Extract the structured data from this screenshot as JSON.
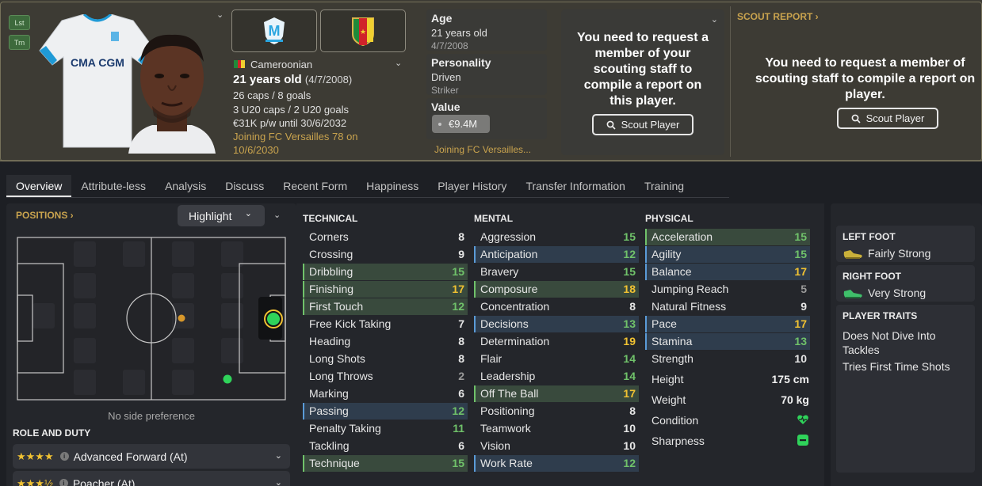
{
  "header": {
    "side_buttons": [
      "Lst",
      "Trn"
    ],
    "nationality": "Cameroonian",
    "age_main": "21 years old",
    "age_dob": "(4/7/2008)",
    "caps": "26 caps / 8 goals",
    "u20_caps": "3 U20 caps / 2 U20 goals",
    "contract": "€31K p/w until 30/6/2032",
    "joining": "Joining FC Versailles 78 on 10/6/2030",
    "colors": {
      "flag_green": "#1f8a3a",
      "flag_red": "#d0232a",
      "flag_yellow": "#f0d030",
      "accent_gold": "#c9a34e"
    }
  },
  "cards": {
    "age_title": "Age",
    "age_value": "21 years old",
    "age_dob": "4/7/2008",
    "personality_title": "Personality",
    "personality_value": "Driven",
    "personality_sub": "Striker",
    "value_title": "Value",
    "value_amount": "€9.4M",
    "joining_short": "Joining FC Versailles..."
  },
  "scout_box": {
    "message": "You need to request a member of your scouting staff to compile a report on this player.",
    "button": "Scout Player"
  },
  "scout_report": {
    "title": "SCOUT REPORT",
    "message": "You need to request a member of scouting staff to compile a report on player.",
    "button": "Scout Player"
  },
  "tabs": [
    "Overview",
    "Attribute-less",
    "Analysis",
    "Discuss",
    "Recent Form",
    "Happiness",
    "Player History",
    "Transfer Information",
    "Training"
  ],
  "positions": {
    "title": "POSITIONS",
    "highlight_label": "Highlight",
    "no_side": "No side preference"
  },
  "role": {
    "title": "ROLE AND DUTY",
    "roles": [
      {
        "stars": "★★★★",
        "name": "Advanced Forward (At)"
      },
      {
        "stars": "★★★½",
        "name": "Poacher (At)"
      }
    ]
  },
  "attributes": {
    "technical_title": "TECHNICAL",
    "mental_title": "MENTAL",
    "physical_title": "PHYSICAL",
    "technical": [
      {
        "name": "Corners",
        "value": "8",
        "hl": ""
      },
      {
        "name": "Crossing",
        "value": "9",
        "hl": ""
      },
      {
        "name": "Dribbling",
        "value": "15",
        "hl": "g"
      },
      {
        "name": "Finishing",
        "value": "17",
        "hl": "g"
      },
      {
        "name": "First Touch",
        "value": "12",
        "hl": "g"
      },
      {
        "name": "Free Kick Taking",
        "value": "7",
        "hl": ""
      },
      {
        "name": "Heading",
        "value": "8",
        "hl": ""
      },
      {
        "name": "Long Shots",
        "value": "8",
        "hl": ""
      },
      {
        "name": "Long Throws",
        "value": "2",
        "hl": ""
      },
      {
        "name": "Marking",
        "value": "6",
        "hl": ""
      },
      {
        "name": "Passing",
        "value": "12",
        "hl": "b"
      },
      {
        "name": "Penalty Taking",
        "value": "11",
        "hl": ""
      },
      {
        "name": "Tackling",
        "value": "6",
        "hl": ""
      },
      {
        "name": "Technique",
        "value": "15",
        "hl": "g"
      }
    ],
    "mental": [
      {
        "name": "Aggression",
        "value": "15",
        "hl": ""
      },
      {
        "name": "Anticipation",
        "value": "12",
        "hl": "b"
      },
      {
        "name": "Bravery",
        "value": "15",
        "hl": ""
      },
      {
        "name": "Composure",
        "value": "18",
        "hl": "g"
      },
      {
        "name": "Concentration",
        "value": "8",
        "hl": ""
      },
      {
        "name": "Decisions",
        "value": "13",
        "hl": "b"
      },
      {
        "name": "Determination",
        "value": "19",
        "hl": ""
      },
      {
        "name": "Flair",
        "value": "14",
        "hl": ""
      },
      {
        "name": "Leadership",
        "value": "14",
        "hl": ""
      },
      {
        "name": "Off The Ball",
        "value": "17",
        "hl": "g"
      },
      {
        "name": "Positioning",
        "value": "8",
        "hl": ""
      },
      {
        "name": "Teamwork",
        "value": "10",
        "hl": ""
      },
      {
        "name": "Vision",
        "value": "10",
        "hl": ""
      },
      {
        "name": "Work Rate",
        "value": "12",
        "hl": "b"
      }
    ],
    "physical": [
      {
        "name": "Acceleration",
        "value": "15",
        "hl": "g"
      },
      {
        "name": "Agility",
        "value": "15",
        "hl": "b"
      },
      {
        "name": "Balance",
        "value": "17",
        "hl": "b"
      },
      {
        "name": "Jumping Reach",
        "value": "5",
        "hl": ""
      },
      {
        "name": "Natural Fitness",
        "value": "9",
        "hl": ""
      },
      {
        "name": "Pace",
        "value": "17",
        "hl": "b"
      },
      {
        "name": "Stamina",
        "value": "13",
        "hl": "b"
      },
      {
        "name": "Strength",
        "value": "10",
        "hl": ""
      }
    ],
    "height_label": "Height",
    "height_value": "175 cm",
    "weight_label": "Weight",
    "weight_value": "70 kg",
    "condition_label": "Condition",
    "condition_icon": "heart-icon",
    "sharpness_label": "Sharpness",
    "sharpness_icon": "minus-square-icon",
    "value_colors": {
      "high": "#f1c232",
      "good": "#70c26a",
      "mid": "#e6e6e6",
      "low": "#9a9a9a"
    }
  },
  "traits": {
    "left_foot_title": "LEFT FOOT",
    "left_foot_value": "Fairly Strong",
    "right_foot_title": "RIGHT FOOT",
    "right_foot_value": "Very Strong",
    "player_traits_title": "PLAYER TRAITS",
    "player_traits": [
      "Does Not Dive Into Tackles",
      "Tries First Time Shots"
    ]
  }
}
